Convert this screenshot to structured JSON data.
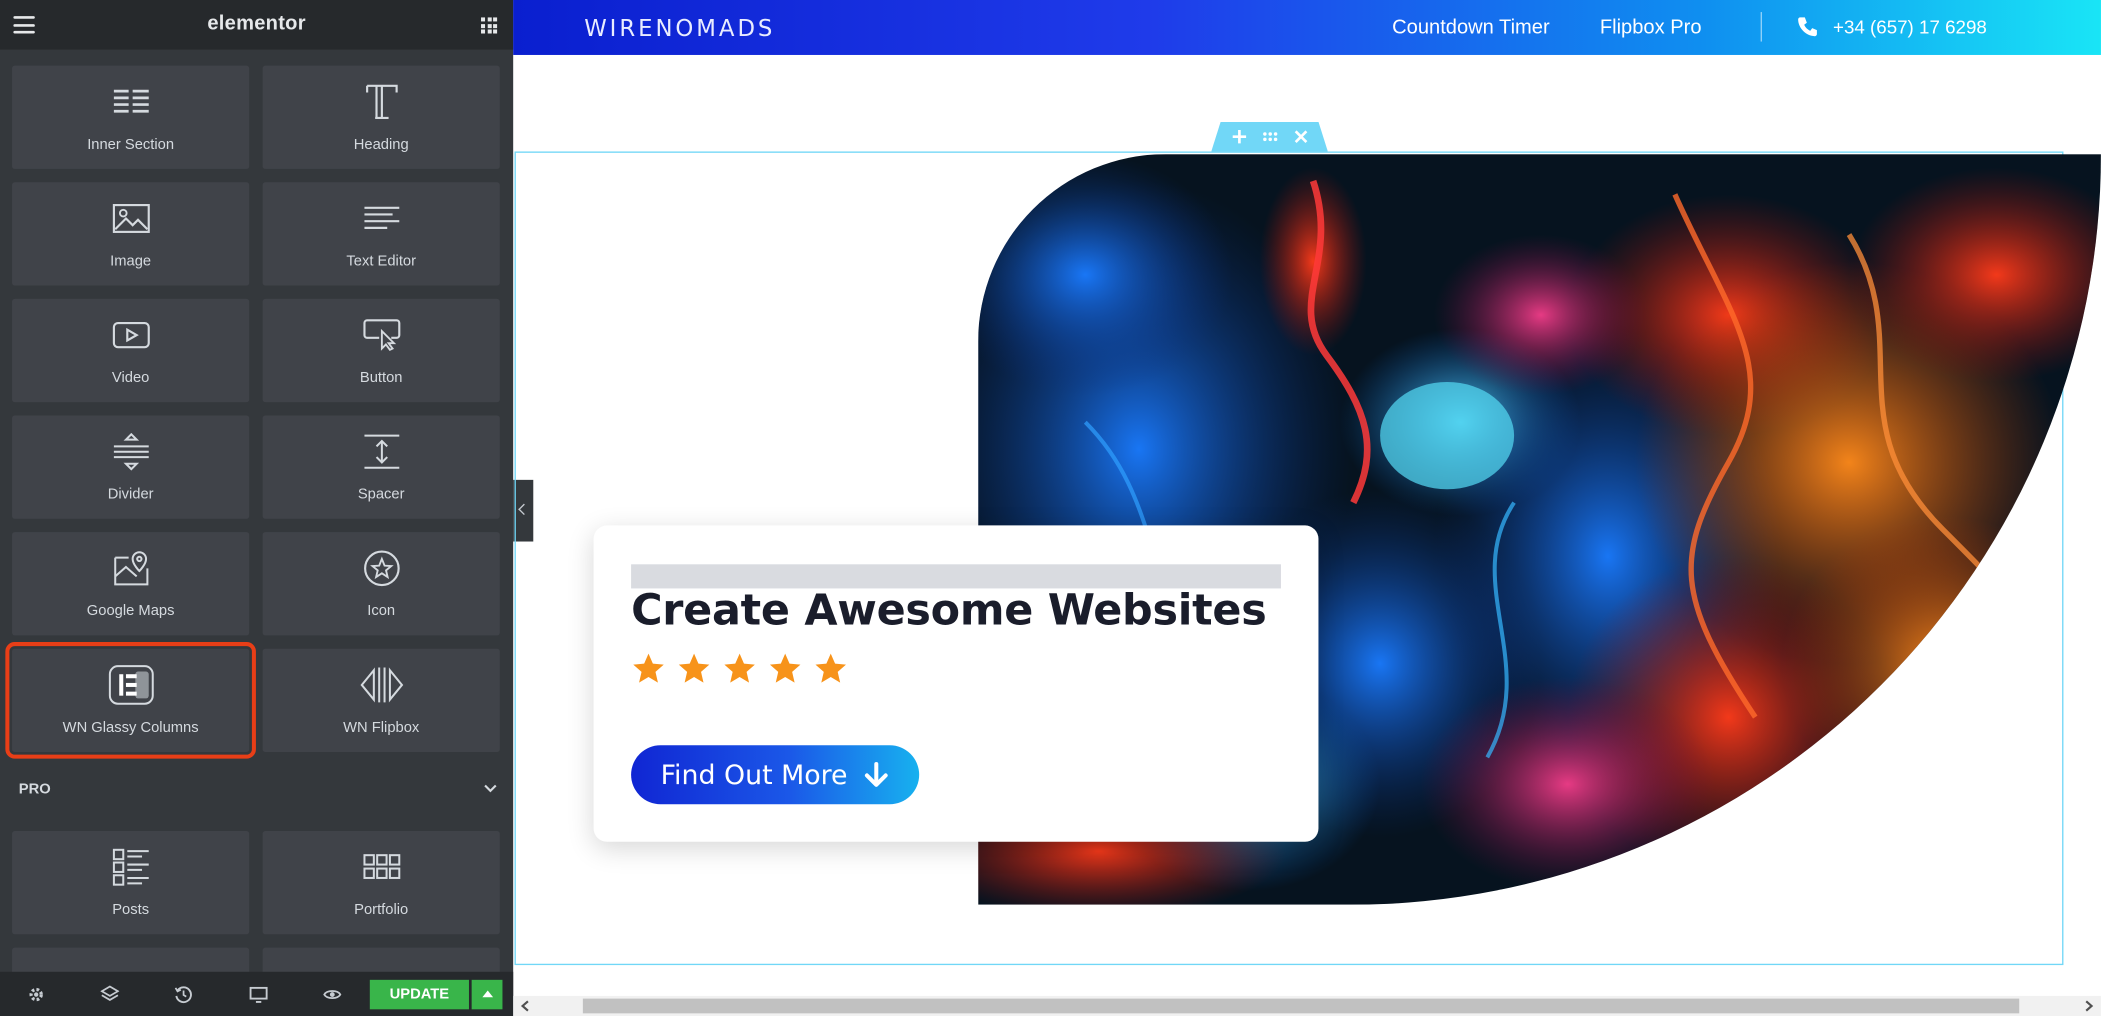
{
  "sidebar": {
    "title": "elementor",
    "widgets": [
      {
        "label": "Inner Section",
        "icon": "inner-section-icon"
      },
      {
        "label": "Heading",
        "icon": "heading-icon"
      },
      {
        "label": "Image",
        "icon": "image-icon"
      },
      {
        "label": "Text Editor",
        "icon": "text-editor-icon"
      },
      {
        "label": "Video",
        "icon": "video-icon"
      },
      {
        "label": "Button",
        "icon": "button-icon"
      },
      {
        "label": "Divider",
        "icon": "divider-icon"
      },
      {
        "label": "Spacer",
        "icon": "spacer-icon"
      },
      {
        "label": "Google Maps",
        "icon": "google-maps-icon"
      },
      {
        "label": "Icon",
        "icon": "star-circle-icon"
      },
      {
        "label": "WN Glassy Columns",
        "icon": "glassy-columns-icon",
        "selected": true
      },
      {
        "label": "WN Flipbox",
        "icon": "flipbox-icon"
      }
    ],
    "pro_section": {
      "label": "PRO"
    },
    "pro_widgets": [
      {
        "label": "Posts",
        "icon": "posts-icon"
      },
      {
        "label": "Portfolio",
        "icon": "portfolio-icon"
      }
    ],
    "footer": {
      "update_label": "UPDATE"
    },
    "accent_color": "#39b54a",
    "highlight_color": "#e83e17"
  },
  "header": {
    "logo": "WIRENOMADS",
    "nav": [
      "Countdown Timer",
      "Flipbox Pro"
    ],
    "phone": "+34 (657) 17 6298"
  },
  "hero": {
    "heading": "Create Awesome Websites",
    "rating": 5,
    "cta_label": "Find Out More"
  },
  "colors": {
    "topbar_start": "#0a1fcf",
    "topbar_end": "#19e5f6",
    "star": "#f7931a",
    "section_outline": "#71d7f7"
  }
}
